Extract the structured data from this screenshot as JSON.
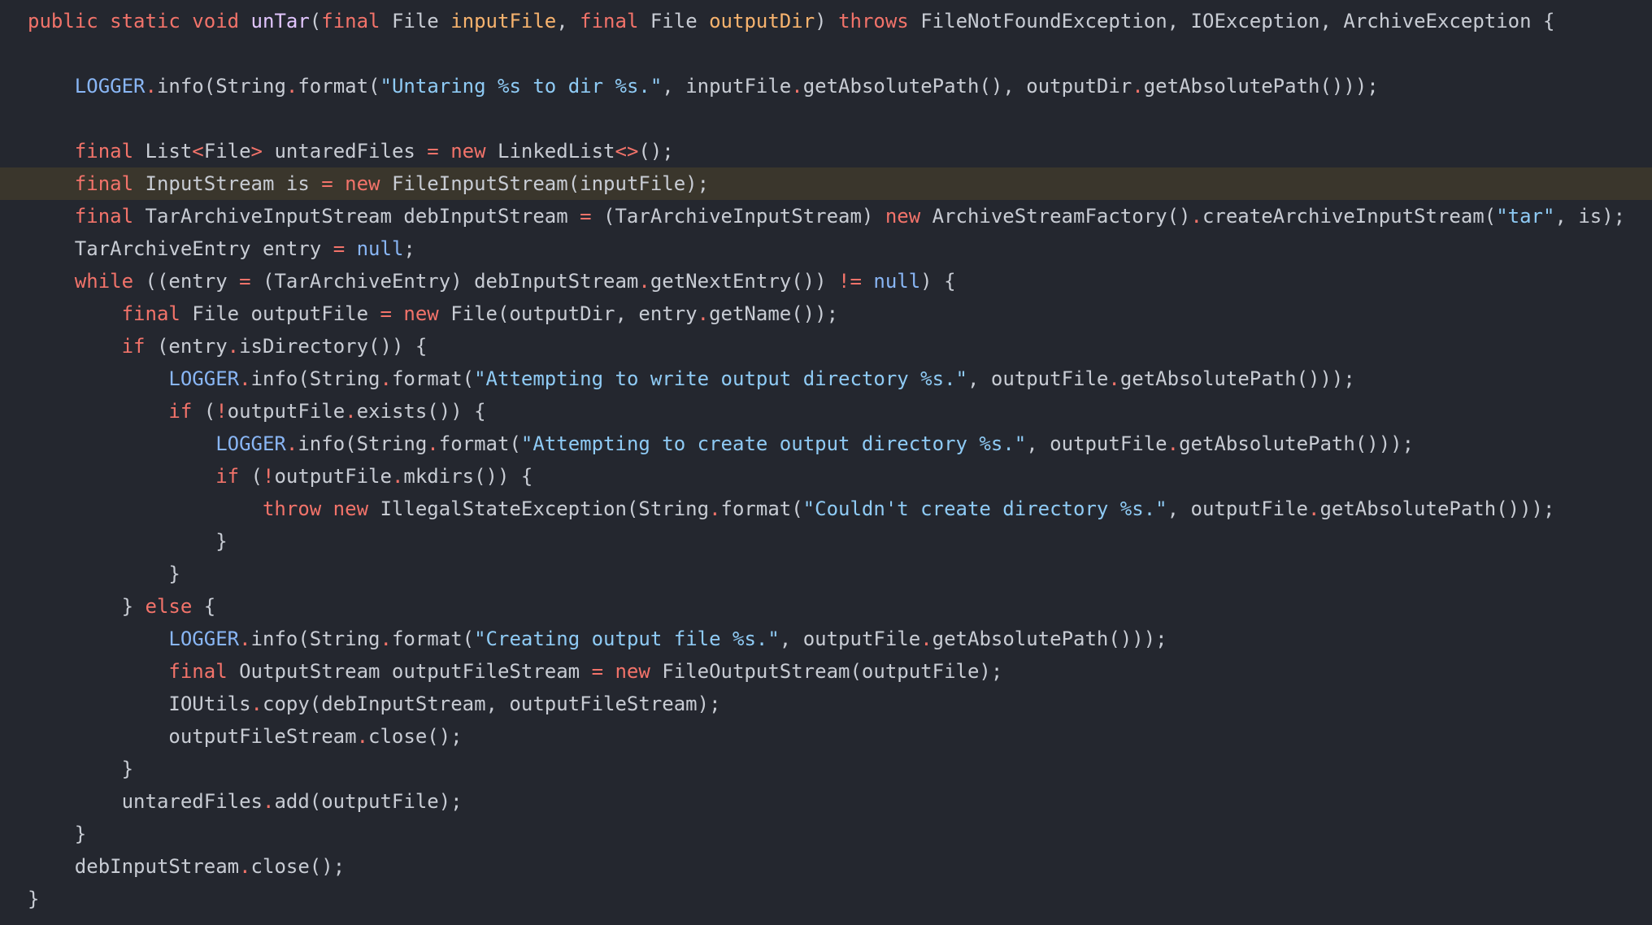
{
  "editor": {
    "highlighted_line": 6,
    "colors": {
      "background": "#24272f",
      "highlight": "#3a362c",
      "keyword": "#f2736a",
      "function_name": "#e2c6ff",
      "parameter": "#f7b36e",
      "string": "#8fcbf5",
      "constant": "#89b6f5",
      "text": "#c8ccd4"
    },
    "lines": [
      [
        {
          "t": "kw",
          "v": "public static void "
        },
        {
          "t": "fn",
          "v": "unTar"
        },
        {
          "t": "tx",
          "v": "("
        },
        {
          "t": "kw",
          "v": "final "
        },
        {
          "t": "tx",
          "v": "File "
        },
        {
          "t": "pm",
          "v": "inputFile"
        },
        {
          "t": "tx",
          "v": ", "
        },
        {
          "t": "kw",
          "v": "final "
        },
        {
          "t": "tx",
          "v": "File "
        },
        {
          "t": "pm",
          "v": "outputDir"
        },
        {
          "t": "tx",
          "v": ") "
        },
        {
          "t": "kw",
          "v": "throws "
        },
        {
          "t": "tx",
          "v": "FileNotFoundException, IOException, ArchiveException {"
        }
      ],
      [],
      [
        {
          "t": "tx",
          "v": "    "
        },
        {
          "t": "cn",
          "v": "LOGGER"
        },
        {
          "t": "op",
          "v": "."
        },
        {
          "t": "tx",
          "v": "info(String"
        },
        {
          "t": "op",
          "v": "."
        },
        {
          "t": "tx",
          "v": "format("
        },
        {
          "t": "st",
          "v": "\"Untaring %s to dir %s.\""
        },
        {
          "t": "tx",
          "v": ", inputFile"
        },
        {
          "t": "op",
          "v": "."
        },
        {
          "t": "tx",
          "v": "getAbsolutePath(), outputDir"
        },
        {
          "t": "op",
          "v": "."
        },
        {
          "t": "tx",
          "v": "getAbsolutePath()));"
        }
      ],
      [],
      [
        {
          "t": "tx",
          "v": "    "
        },
        {
          "t": "kw",
          "v": "final "
        },
        {
          "t": "tx",
          "v": "List"
        },
        {
          "t": "op",
          "v": "<"
        },
        {
          "t": "tx",
          "v": "File"
        },
        {
          "t": "op",
          "v": ">"
        },
        {
          "t": "tx",
          "v": " untaredFiles "
        },
        {
          "t": "op",
          "v": "= "
        },
        {
          "t": "kw",
          "v": "new "
        },
        {
          "t": "tx",
          "v": "LinkedList"
        },
        {
          "t": "op",
          "v": "<>"
        },
        {
          "t": "tx",
          "v": "();"
        }
      ],
      [
        {
          "t": "tx",
          "v": "    "
        },
        {
          "t": "kw",
          "v": "final "
        },
        {
          "t": "tx",
          "v": "InputStream is "
        },
        {
          "t": "op",
          "v": "= "
        },
        {
          "t": "kw",
          "v": "new "
        },
        {
          "t": "tx",
          "v": "FileInputStream(inputFile);"
        }
      ],
      [
        {
          "t": "tx",
          "v": "    "
        },
        {
          "t": "kw",
          "v": "final "
        },
        {
          "t": "tx",
          "v": "TarArchiveInputStream debInputStream "
        },
        {
          "t": "op",
          "v": "= "
        },
        {
          "t": "tx",
          "v": "(TarArchiveInputStream) "
        },
        {
          "t": "kw",
          "v": "new "
        },
        {
          "t": "tx",
          "v": "ArchiveStreamFactory()"
        },
        {
          "t": "op",
          "v": "."
        },
        {
          "t": "tx",
          "v": "createArchiveInputStream("
        },
        {
          "t": "st",
          "v": "\"tar\""
        },
        {
          "t": "tx",
          "v": ", is);"
        }
      ],
      [
        {
          "t": "tx",
          "v": "    TarArchiveEntry entry "
        },
        {
          "t": "op",
          "v": "= "
        },
        {
          "t": "cn",
          "v": "null"
        },
        {
          "t": "tx",
          "v": ";"
        }
      ],
      [
        {
          "t": "tx",
          "v": "    "
        },
        {
          "t": "kw",
          "v": "while "
        },
        {
          "t": "tx",
          "v": "((entry "
        },
        {
          "t": "op",
          "v": "= "
        },
        {
          "t": "tx",
          "v": "(TarArchiveEntry) debInputStream"
        },
        {
          "t": "op",
          "v": "."
        },
        {
          "t": "tx",
          "v": "getNextEntry()) "
        },
        {
          "t": "op",
          "v": "!= "
        },
        {
          "t": "cn",
          "v": "null"
        },
        {
          "t": "tx",
          "v": ") {"
        }
      ],
      [
        {
          "t": "tx",
          "v": "        "
        },
        {
          "t": "kw",
          "v": "final "
        },
        {
          "t": "tx",
          "v": "File outputFile "
        },
        {
          "t": "op",
          "v": "= "
        },
        {
          "t": "kw",
          "v": "new "
        },
        {
          "t": "tx",
          "v": "File(outputDir, entry"
        },
        {
          "t": "op",
          "v": "."
        },
        {
          "t": "tx",
          "v": "getName());"
        }
      ],
      [
        {
          "t": "tx",
          "v": "        "
        },
        {
          "t": "kw",
          "v": "if "
        },
        {
          "t": "tx",
          "v": "(entry"
        },
        {
          "t": "op",
          "v": "."
        },
        {
          "t": "tx",
          "v": "isDirectory()) {"
        }
      ],
      [
        {
          "t": "tx",
          "v": "            "
        },
        {
          "t": "cn",
          "v": "LOGGER"
        },
        {
          "t": "op",
          "v": "."
        },
        {
          "t": "tx",
          "v": "info(String"
        },
        {
          "t": "op",
          "v": "."
        },
        {
          "t": "tx",
          "v": "format("
        },
        {
          "t": "st",
          "v": "\"Attempting to write output directory %s.\""
        },
        {
          "t": "tx",
          "v": ", outputFile"
        },
        {
          "t": "op",
          "v": "."
        },
        {
          "t": "tx",
          "v": "getAbsolutePath()));"
        }
      ],
      [
        {
          "t": "tx",
          "v": "            "
        },
        {
          "t": "kw",
          "v": "if "
        },
        {
          "t": "tx",
          "v": "("
        },
        {
          "t": "op",
          "v": "!"
        },
        {
          "t": "tx",
          "v": "outputFile"
        },
        {
          "t": "op",
          "v": "."
        },
        {
          "t": "tx",
          "v": "exists()) {"
        }
      ],
      [
        {
          "t": "tx",
          "v": "                "
        },
        {
          "t": "cn",
          "v": "LOGGER"
        },
        {
          "t": "op",
          "v": "."
        },
        {
          "t": "tx",
          "v": "info(String"
        },
        {
          "t": "op",
          "v": "."
        },
        {
          "t": "tx",
          "v": "format("
        },
        {
          "t": "st",
          "v": "\"Attempting to create output directory %s.\""
        },
        {
          "t": "tx",
          "v": ", outputFile"
        },
        {
          "t": "op",
          "v": "."
        },
        {
          "t": "tx",
          "v": "getAbsolutePath()));"
        }
      ],
      [
        {
          "t": "tx",
          "v": "                "
        },
        {
          "t": "kw",
          "v": "if "
        },
        {
          "t": "tx",
          "v": "("
        },
        {
          "t": "op",
          "v": "!"
        },
        {
          "t": "tx",
          "v": "outputFile"
        },
        {
          "t": "op",
          "v": "."
        },
        {
          "t": "tx",
          "v": "mkdirs()) {"
        }
      ],
      [
        {
          "t": "tx",
          "v": "                    "
        },
        {
          "t": "kw",
          "v": "throw new "
        },
        {
          "t": "tx",
          "v": "IllegalStateException(String"
        },
        {
          "t": "op",
          "v": "."
        },
        {
          "t": "tx",
          "v": "format("
        },
        {
          "t": "st",
          "v": "\"Couldn't create directory %s.\""
        },
        {
          "t": "tx",
          "v": ", outputFile"
        },
        {
          "t": "op",
          "v": "."
        },
        {
          "t": "tx",
          "v": "getAbsolutePath()));"
        }
      ],
      [
        {
          "t": "tx",
          "v": "                }"
        }
      ],
      [
        {
          "t": "tx",
          "v": "            }"
        }
      ],
      [
        {
          "t": "tx",
          "v": "        } "
        },
        {
          "t": "kw",
          "v": "else "
        },
        {
          "t": "tx",
          "v": "{"
        }
      ],
      [
        {
          "t": "tx",
          "v": "            "
        },
        {
          "t": "cn",
          "v": "LOGGER"
        },
        {
          "t": "op",
          "v": "."
        },
        {
          "t": "tx",
          "v": "info(String"
        },
        {
          "t": "op",
          "v": "."
        },
        {
          "t": "tx",
          "v": "format("
        },
        {
          "t": "st",
          "v": "\"Creating output file %s.\""
        },
        {
          "t": "tx",
          "v": ", outputFile"
        },
        {
          "t": "op",
          "v": "."
        },
        {
          "t": "tx",
          "v": "getAbsolutePath()));"
        }
      ],
      [
        {
          "t": "tx",
          "v": "            "
        },
        {
          "t": "kw",
          "v": "final "
        },
        {
          "t": "tx",
          "v": "OutputStream outputFileStream "
        },
        {
          "t": "op",
          "v": "= "
        },
        {
          "t": "kw",
          "v": "new "
        },
        {
          "t": "tx",
          "v": "FileOutputStream(outputFile);"
        }
      ],
      [
        {
          "t": "tx",
          "v": "            IOUtils"
        },
        {
          "t": "op",
          "v": "."
        },
        {
          "t": "tx",
          "v": "copy(debInputStream, outputFileStream);"
        }
      ],
      [
        {
          "t": "tx",
          "v": "            outputFileStream"
        },
        {
          "t": "op",
          "v": "."
        },
        {
          "t": "tx",
          "v": "close();"
        }
      ],
      [
        {
          "t": "tx",
          "v": "        }"
        }
      ],
      [
        {
          "t": "tx",
          "v": "        untaredFiles"
        },
        {
          "t": "op",
          "v": "."
        },
        {
          "t": "tx",
          "v": "add(outputFile);"
        }
      ],
      [
        {
          "t": "tx",
          "v": "    }"
        }
      ],
      [
        {
          "t": "tx",
          "v": "    debInputStream"
        },
        {
          "t": "op",
          "v": "."
        },
        {
          "t": "tx",
          "v": "close();"
        }
      ],
      [
        {
          "t": "tx",
          "v": "}"
        }
      ]
    ]
  }
}
